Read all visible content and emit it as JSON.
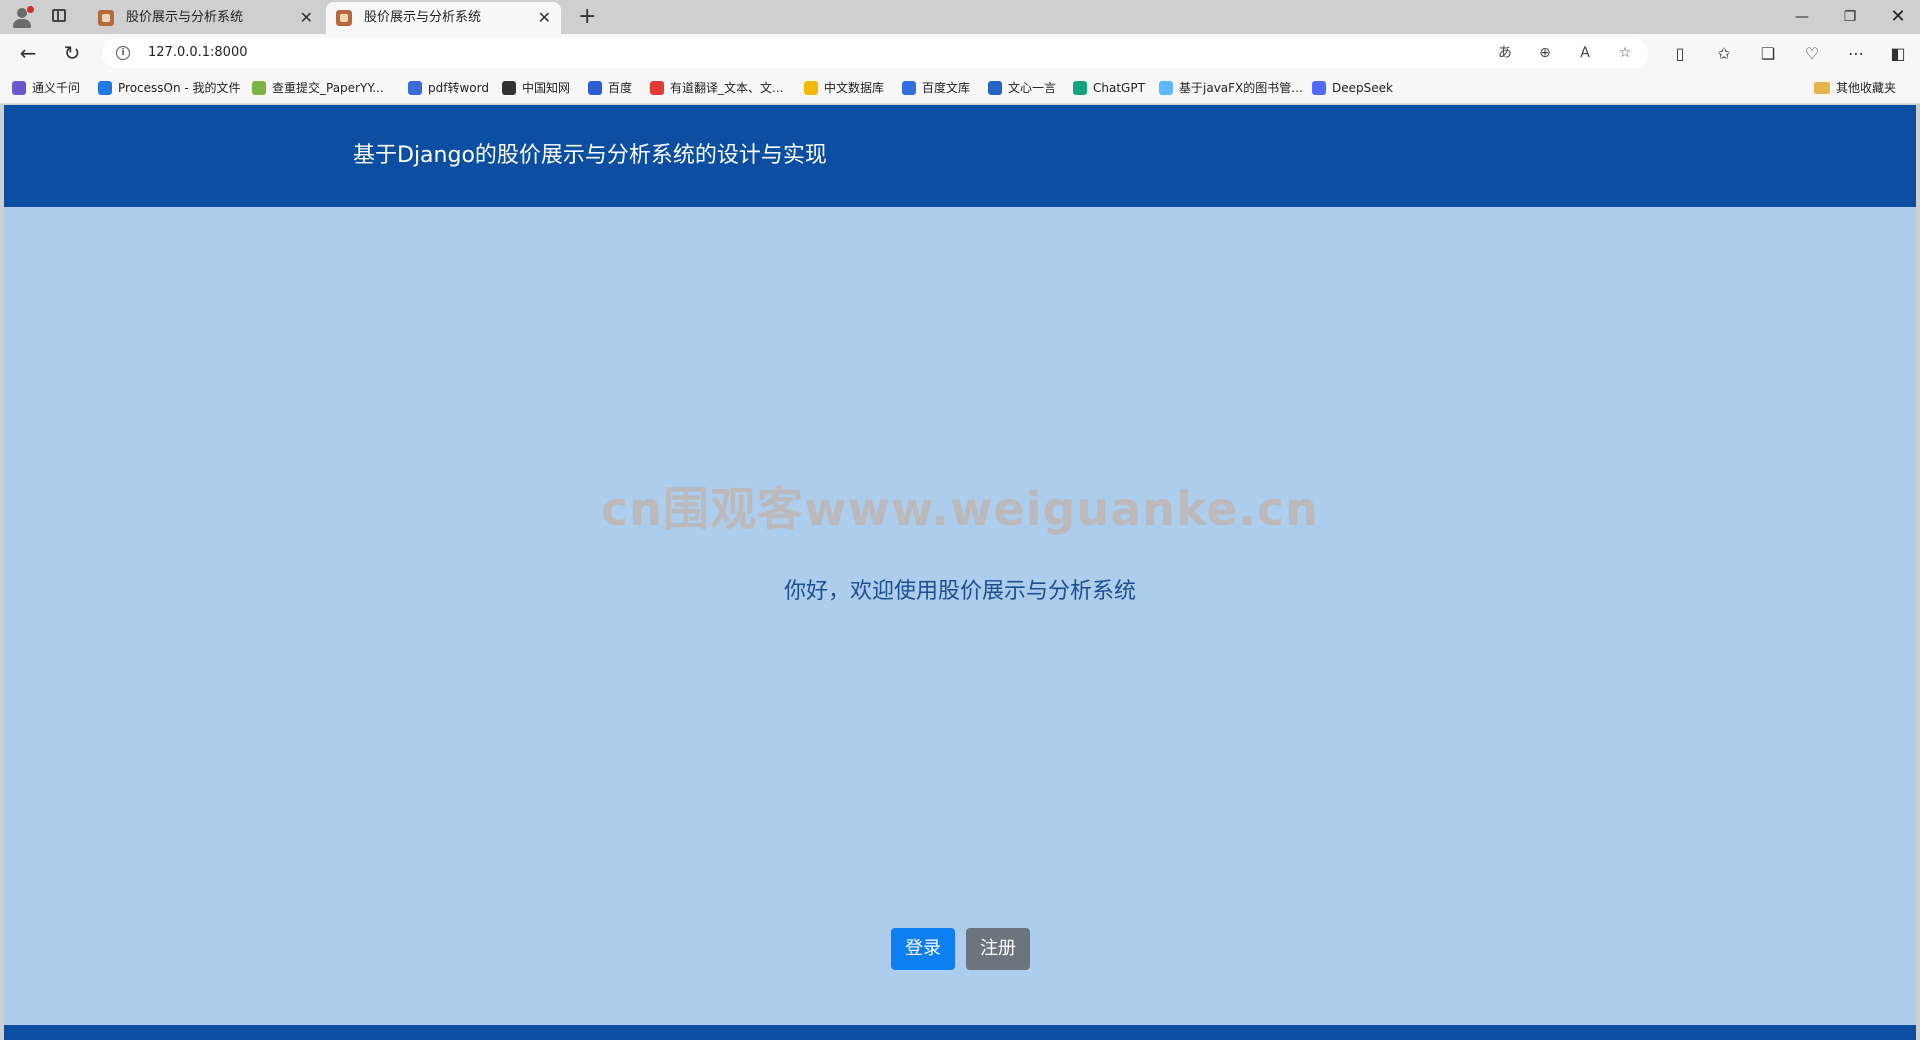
{
  "browser": {
    "tabs": [
      {
        "title": "股价展示与分析系统",
        "active": false
      },
      {
        "title": "股价展示与分析系统",
        "active": true
      }
    ],
    "new_tab_glyph": "+",
    "close_glyph": "✕",
    "window_controls": {
      "minimize": "—",
      "restore": "❐",
      "close": "✕"
    },
    "address": "127.0.0.1:8000",
    "bookmarks": [
      {
        "label": "通义千问",
        "color": "#6a5acd"
      },
      {
        "label": "ProcessOn - 我的文件",
        "color": "#1f7ae0"
      },
      {
        "label": "查重提交_PaperYY...",
        "color": "#7cb342"
      },
      {
        "label": "pdf转word",
        "color": "#3d6bd6"
      },
      {
        "label": "中国知网",
        "color": "#333333"
      },
      {
        "label": "百度",
        "color": "#2f5bd3"
      },
      {
        "label": "有道翻译_文本、文...",
        "color": "#e53935"
      },
      {
        "label": "中文数据库",
        "color": "#f5b800"
      },
      {
        "label": "百度文库",
        "color": "#2f6fe0"
      },
      {
        "label": "文心一言",
        "color": "#2563c8"
      },
      {
        "label": "ChatGPT",
        "color": "#10a37f"
      },
      {
        "label": "基于javaFX的图书管...",
        "color": "#5cb8ff"
      },
      {
        "label": "DeepSeek",
        "color": "#4d6bfe"
      }
    ],
    "other_bookmarks": "其他收藏夹"
  },
  "page": {
    "header_title": "基于Django的股价展示与分析系统的设计与实现",
    "watermark": "cn围观客www.weiguanke.cn",
    "welcome": "你好，欢迎使用股价展示与分析系统",
    "login_label": "登录",
    "register_label": "注册"
  },
  "colors": {
    "header": "#0b4ea2",
    "background": "#adcdec",
    "login_button": "#0d7ff2",
    "register_button": "#6c757d",
    "welcome_text": "#1d4f91"
  }
}
